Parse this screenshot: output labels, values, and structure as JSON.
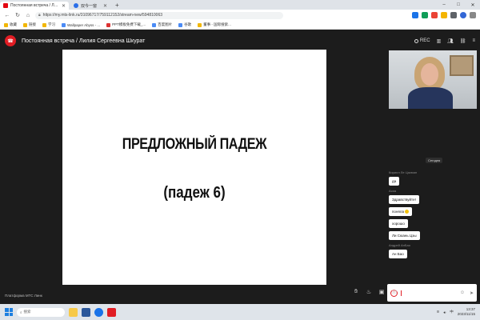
{
  "browser": {
    "tabs": [
      {
        "label": "Постоянная встреча / Ли...",
        "active": true,
        "icon": "mts-icon"
      },
      {
        "label": "双今一窗",
        "active": false,
        "icon": "globe-icon"
      }
    ],
    "new_tab": "+",
    "window_controls": [
      "–",
      "□",
      "✕"
    ],
    "url": "https://my.mts-link.ru/31096717/759112152/stream-new/594810063",
    "bookmarks": [
      "收藏",
      "链接",
      "学习",
      "Wallpaper Abyss - ...",
      "PPT模板免费下载_...",
      "百度图片",
      "谷歌",
      "董事 - 国际搜索..."
    ]
  },
  "meeting": {
    "title": "Постоянная встреча / Лилия Сергеевна Шкурат",
    "rec_label": "REC",
    "slide": {
      "title": "ПРЕДЛОЖНЫЙ ПАДЕЖ",
      "subtitle": "(падеж 6)"
    },
    "video_name": "Cегодня",
    "chat": [
      {
        "sender": "Кирилл Ле Цзиюян",
        "messages": [
          "да"
        ]
      },
      {
        "sender": "Асиа",
        "messages": [
          "Здравствуйте!",
          "поняла",
          "хорошо",
          "Ли Сюань Цзы"
        ]
      },
      {
        "sender": "Андрей АнБао",
        "messages": [
          "Ан Бао"
        ]
      }
    ],
    "footer": "Платформа МТС Линк"
  },
  "taskbar": {
    "search_placeholder": "搜索",
    "time": "13:37",
    "date": "2023/11/15",
    "lang": "中"
  },
  "colors": {
    "app_bg": "#1c1c1c",
    "hangup": "#e11d24",
    "slide_bg": "#ffffff"
  }
}
